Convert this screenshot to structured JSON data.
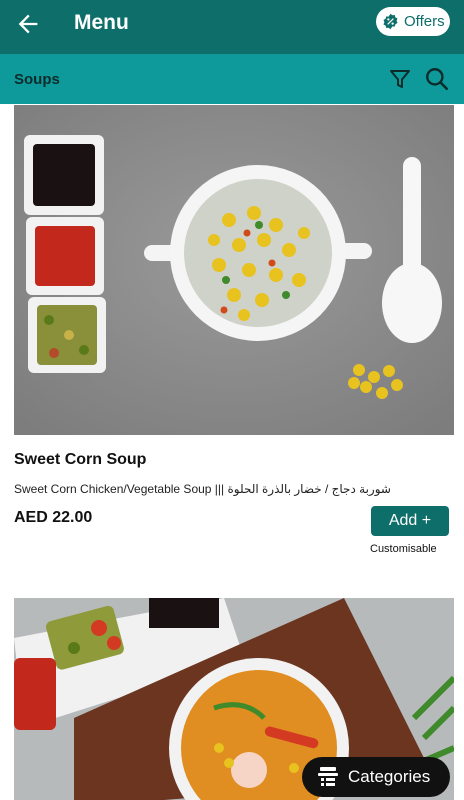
{
  "header": {
    "title": "Menu",
    "back_icon": "arrow-left-icon",
    "offers_label": "Offers",
    "offers_icon": "discount-badge-icon",
    "bg_color": "#0e6e6a"
  },
  "subheader": {
    "title": "Soups",
    "filter_icon": "filter-icon",
    "search_icon": "search-icon",
    "bg_color": "#0e9a9a"
  },
  "items": [
    {
      "name": "Sweet Corn Soup",
      "description": "Sweet Corn Chicken/Vegetable Soup ||| شوربة دجاج / خضار بالذرة الحلوة",
      "price": "AED 22.00",
      "add_label": "Add +",
      "customisable_label": "Customisable"
    }
  ],
  "floating": {
    "categories_label": "Categories",
    "categories_icon": "menu-book-icon"
  }
}
